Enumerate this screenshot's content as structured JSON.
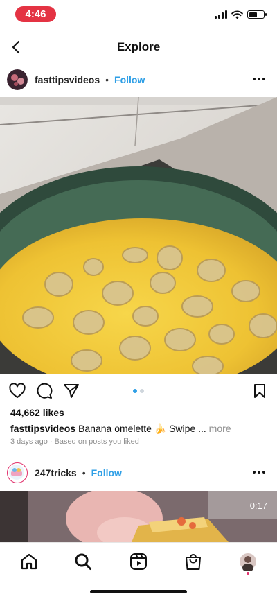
{
  "status_bar": {
    "time": "4:46",
    "battery_level": 0.6
  },
  "header": {
    "title": "Explore"
  },
  "post1": {
    "username": "fasttipsvideos",
    "separator": "•",
    "follow_label": "Follow",
    "likes": "44,662 likes",
    "caption_user": "fasttipsvideos",
    "caption_text": " Banana omelette 🍌 Swipe ...",
    "more_label": " more",
    "meta": "3 days ago · Based on posts you liked",
    "carousel": {
      "count": 2,
      "active": 1
    }
  },
  "post2": {
    "username": "247tricks",
    "separator": "•",
    "follow_label": "Follow",
    "video_time": "0:17"
  },
  "colors": {
    "accent": "#2f9fe6",
    "status_pill": "#e43343"
  },
  "icons": {
    "back": "back-arrow-icon",
    "more": "more-horizontal-icon",
    "like": "heart-icon",
    "comment": "comment-icon",
    "share": "send-icon",
    "save": "bookmark-icon",
    "nav": [
      "home-icon",
      "search-icon",
      "reels-icon",
      "shop-icon",
      "profile-icon"
    ]
  }
}
